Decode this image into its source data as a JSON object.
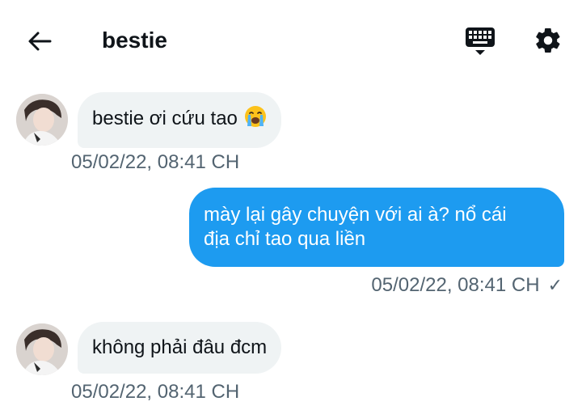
{
  "header": {
    "title": "bestie"
  },
  "icons": {
    "back": "arrow-left-icon",
    "keyboard": "keyboard-icon",
    "settings": "gear-icon"
  },
  "colors": {
    "accent": "#1d9bf0",
    "incoming_bubble": "#eff3f4",
    "timestamp": "#536471"
  },
  "messages": [
    {
      "direction": "incoming",
      "text": "bestie ơi cứu tao",
      "emoji": "crying-face",
      "timestamp": "05/02/22, 08:41 CH"
    },
    {
      "direction": "outgoing",
      "text_line1": "mày lại gây chuyện với ai à? nổ cái",
      "text_line2": "địa chỉ tao qua liền",
      "timestamp": "05/02/22, 08:41 CH",
      "status": "✓"
    },
    {
      "direction": "incoming",
      "text": "không phải đâu đcm",
      "timestamp": "05/02/22, 08:41 CH"
    }
  ]
}
